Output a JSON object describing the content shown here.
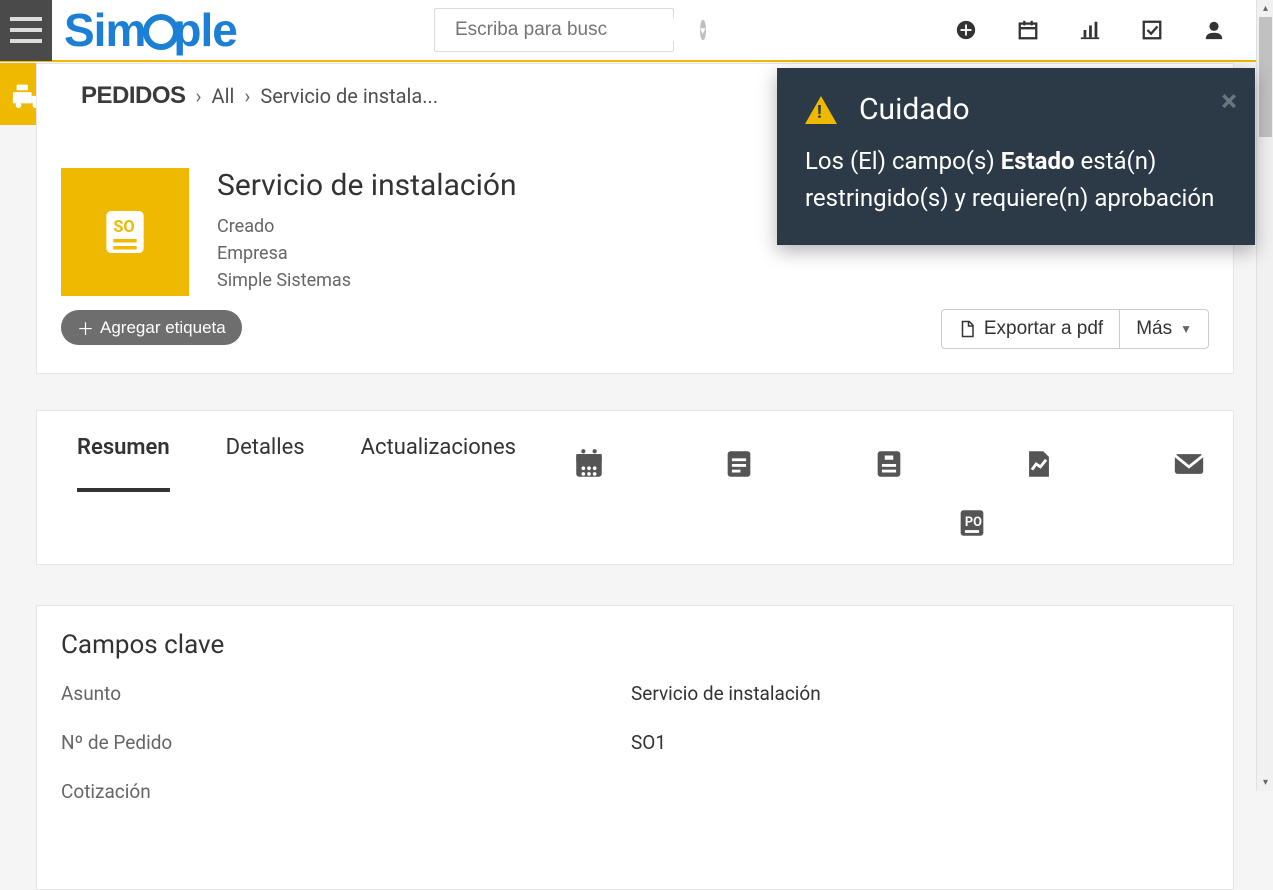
{
  "brand": "Simple",
  "search": {
    "placeholder": "Escriba para busc"
  },
  "side_module": "orders",
  "breadcrumb": {
    "root": "PEDIDOS",
    "items": [
      "All",
      "Servicio de instala..."
    ]
  },
  "record": {
    "title": "Servicio de instalación",
    "status": "Creado",
    "company_label": "Empresa",
    "company_value": "Simple Sistemas",
    "icon_badge": "SO"
  },
  "tag_button": "Agregar etiqueta",
  "actions": {
    "export_pdf": "Exportar a pdf",
    "more": "Más"
  },
  "alert": {
    "title": "Cuidado",
    "body_prefix": "Los (El) campo(s) ",
    "body_bold": "Estado",
    "body_suffix": " está(n) restringido(s) y requiere(n) aprobación"
  },
  "tabs": {
    "text": [
      "Resumen",
      "Detalles",
      "Actualizaciones"
    ],
    "active_index": 0
  },
  "key_fields": {
    "heading": "Campos clave",
    "rows": [
      {
        "label": "Asunto",
        "value": "Servicio de instalación"
      },
      {
        "label": "Nº de Pedido",
        "value": "SO1"
      },
      {
        "label": "Cotización",
        "value": ""
      }
    ]
  }
}
